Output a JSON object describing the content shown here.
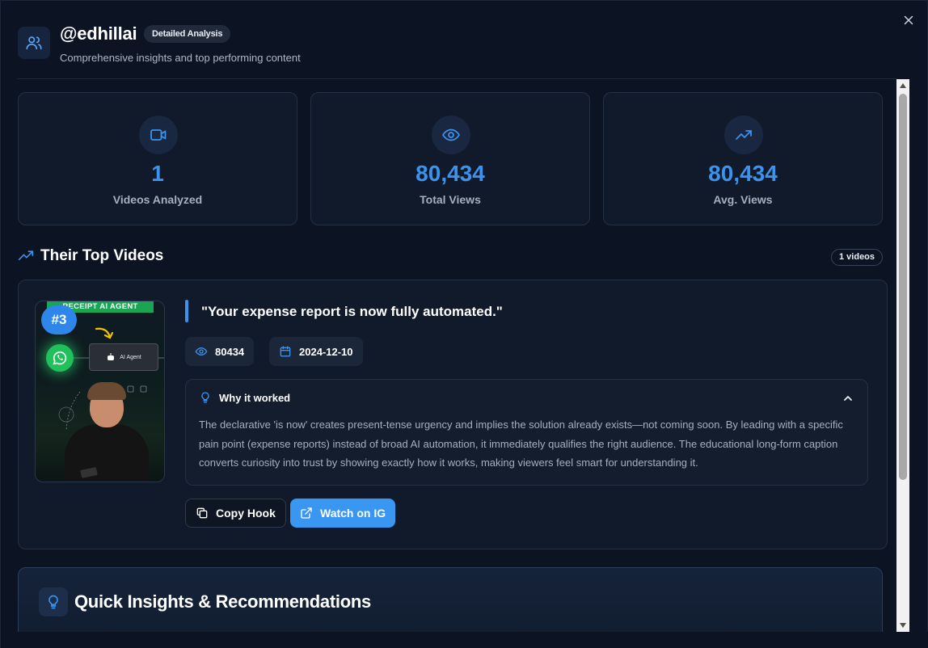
{
  "header": {
    "username": "@edhillai",
    "badge": "Detailed Analysis",
    "subtitle": "Comprehensive insights and top performing content"
  },
  "stats": [
    {
      "value": "1",
      "label": "Videos Analyzed",
      "icon": "video-icon"
    },
    {
      "value": "80,434",
      "label": "Total Views",
      "icon": "eye-icon"
    },
    {
      "value": "80,434",
      "label": "Avg. Views",
      "icon": "trending-up-icon"
    }
  ],
  "top_videos": {
    "title": "Their Top Videos",
    "count_label": "1 videos",
    "videos": [
      {
        "rank": "#3",
        "thumbnail_banner": "RECEIPT AI AGENT",
        "thumbnail_agent_label": "AI Agent",
        "hook": "\"Your expense report is now fully automated.\"",
        "views": "80434",
        "date": "2024-12-10",
        "why_title": "Why it worked",
        "why_text": "The declarative 'is now' creates present-tense urgency and implies the solution already exists—not coming soon. By leading with a specific pain point (expense reports) instead of broad AI automation, it immediately qualifies the right audience. The educational long-form caption converts curiosity into trust by showing exactly how it works, making viewers feel smart for understanding it.",
        "copy_label": "Copy Hook",
        "watch_label": "Watch on IG"
      }
    ]
  },
  "insights": {
    "title": "Quick Insights & Recommendations"
  },
  "colors": {
    "accent": "#3a93ef",
    "background": "#0c1424",
    "card": "#111a2b",
    "whatsapp": "#20c05b"
  }
}
